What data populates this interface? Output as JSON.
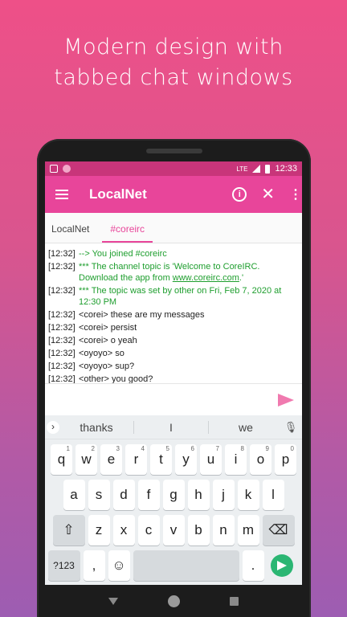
{
  "headline": {
    "line1": "Modern design with",
    "line2": "tabbed chat windows"
  },
  "status_bar": {
    "network": "LTE",
    "time": "12:33"
  },
  "app_bar": {
    "title": "LocalNet"
  },
  "tabs": [
    {
      "label": "LocalNet",
      "active": false
    },
    {
      "label": "#coreirc",
      "active": true
    }
  ],
  "messages": [
    {
      "time": "[12:32]",
      "text": "--> You joined #coreirc",
      "system": true
    },
    {
      "time": "[12:32]",
      "text_before": "*** The channel topic is 'Welcome to CoreIRC. Download the app from ",
      "link": "www.coreirc.com",
      "text_after": ".'",
      "system": true
    },
    {
      "time": "[12:32]",
      "text": "*** The topic was set by other on Fri, Feb 7, 2020 at 12:30 PM",
      "system": true
    },
    {
      "time": "[12:32]",
      "text": "<corei> these are my messages",
      "system": false
    },
    {
      "time": "[12:32]",
      "text": "<corei> persist",
      "system": false
    },
    {
      "time": "[12:32]",
      "text": "<corei> o yeah",
      "system": false
    },
    {
      "time": "[12:32]",
      "text": "<oyoyo> so",
      "system": false
    },
    {
      "time": "[12:32]",
      "text": "<oyoyo> sup?",
      "system": false
    },
    {
      "time": "[12:32]",
      "text": "<other> you good?",
      "system": false
    }
  ],
  "input": {
    "value": ""
  },
  "keyboard": {
    "suggestions": [
      "thanks",
      "I",
      "we"
    ],
    "row1": [
      "q",
      "w",
      "e",
      "r",
      "t",
      "y",
      "u",
      "i",
      "o",
      "p"
    ],
    "row1_nums": [
      "1",
      "2",
      "3",
      "4",
      "5",
      "6",
      "7",
      "8",
      "9",
      "0"
    ],
    "row2": [
      "a",
      "s",
      "d",
      "f",
      "g",
      "h",
      "j",
      "k",
      "l"
    ],
    "row3": [
      "z",
      "x",
      "c",
      "v",
      "b",
      "n",
      "m"
    ],
    "symbols_label": "?123",
    "comma": ",",
    "period": "."
  },
  "colors": {
    "accent": "#e8459a",
    "system_text": "#1e9e2e",
    "enter": "#2bb673"
  }
}
